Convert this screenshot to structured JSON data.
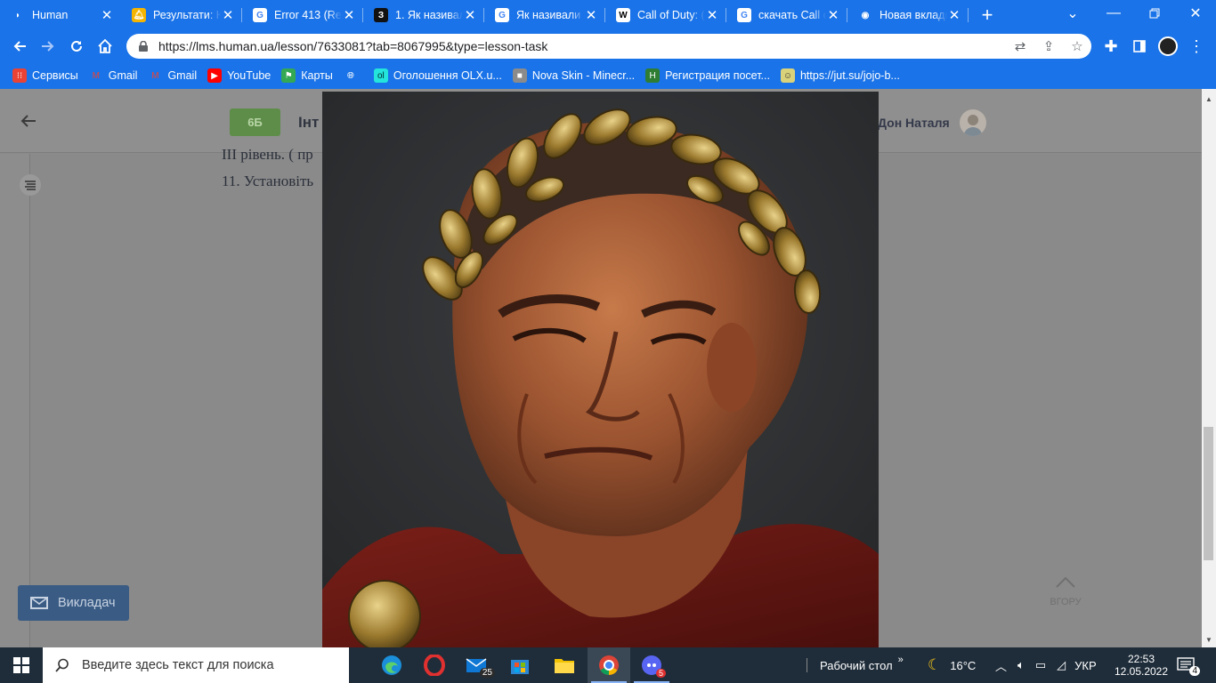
{
  "browser": {
    "tabs": [
      {
        "title": "Human",
        "favicon": "human-logo-icon",
        "active": true
      },
      {
        "title": "Результати: К",
        "favicon": "bell-icon"
      },
      {
        "title": "Error 413 (Re",
        "favicon": "google-icon"
      },
      {
        "title": "1. Як називал",
        "favicon": "znanija-icon"
      },
      {
        "title": "Як називали",
        "favicon": "google-icon"
      },
      {
        "title": "Call of Duty: (",
        "favicon": "wikipedia-icon"
      },
      {
        "title": "скачать Call o",
        "favicon": "google-icon"
      },
      {
        "title": "Новая вкладк",
        "favicon": "chrome-icon"
      }
    ],
    "url": "https://lms.human.ua/lesson/7633081?tab=8067995&type=lesson-task",
    "bookmarks": [
      {
        "label": "Сервисы",
        "icon": "apps-grid-icon"
      },
      {
        "label": "Gmail",
        "icon": "gmail-icon"
      },
      {
        "label": "Gmail",
        "icon": "gmail-icon"
      },
      {
        "label": "YouTube",
        "icon": "youtube-icon"
      },
      {
        "label": "Карты",
        "icon": "maps-icon"
      },
      {
        "label": "",
        "icon": "globe-icon"
      },
      {
        "label": "Оголошення OLX.u...",
        "icon": "olx-icon"
      },
      {
        "label": "Nova Skin - Minecr...",
        "icon": "minecraft-block-icon"
      },
      {
        "label": "Регистрация посет...",
        "icon": "h-logo-icon"
      },
      {
        "label": "https://jut.su/jojo-b...",
        "icon": "jutsu-icon"
      }
    ]
  },
  "page": {
    "class_badge": "6Б",
    "subject_partial": "Інт",
    "teacher_name_partial": "Дон Наталя",
    "task_lines": [
      "ІІІ рівень. ( пр",
      "11. Установіть"
    ],
    "teacher_button": "Викладач",
    "to_top": "ВГОРУ"
  },
  "taskbar": {
    "search_placeholder": "Введите здесь текст для поиска",
    "mail_badge": "25",
    "discord_badge": "5",
    "desktop_label": "Рабочий стол",
    "weather": "16°C",
    "language": "УКР",
    "time": "22:53",
    "date": "12.05.2022",
    "notifications": "4"
  }
}
